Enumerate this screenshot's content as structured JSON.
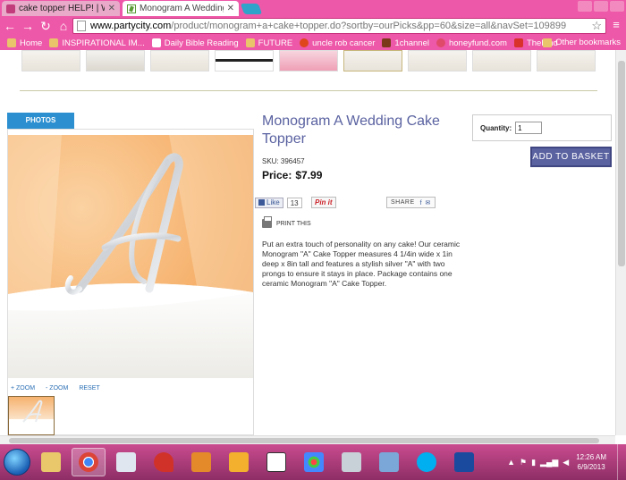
{
  "browser": {
    "tabs": [
      {
        "title": "cake topper HELP! | Wedd",
        "active": false
      },
      {
        "title": "Monogram A Wedding C",
        "active": true
      }
    ],
    "url_host": "www.partycity.com",
    "url_path": "/product/monogram+a+cake+topper.do?sortby=ourPicks&pp=60&size=all&navSet=109899",
    "bookmarks": [
      "Home",
      "INSPIRATIONAL IM...",
      "Daily Bible Reading",
      "FUTURE",
      "uncle rob cancer",
      "1channel",
      "honeyfund.com",
      "TheFind"
    ],
    "other_bookmarks": "Other bookmarks"
  },
  "product": {
    "photos_tab": "PHOTOS",
    "title": "Monogram A Wedding Cake Topper",
    "sku": "SKU: 396457",
    "price_label": "Price:",
    "price": "$7.99",
    "quantity_label": "Quantity:",
    "quantity_value": "1",
    "add_to_basket": "ADD TO BASKET",
    "zoom_in": "+ ZOOM",
    "zoom_out": "- ZOOM",
    "reset": "RESET",
    "like_label": "Like",
    "like_count": "13",
    "pin_label": "Pin it",
    "share_label": "SHARE",
    "print_label": "PRINT THIS",
    "description": "Put an extra touch of personality on any cake! Our ceramic Monogram \"A\" Cake Topper measures 4 1/4in wide x 1in deep x 8in tall and features a stylish silver \"A\" with two prongs to ensure it stays in place. Package contains one ceramic Monogram \"A\" Cake Topper."
  },
  "taskbar": {
    "time": "12:26 AM",
    "date": "6/9/2013"
  },
  "colors": {
    "browser_chrome": "#ee58a8",
    "title_blue": "#5a62a0",
    "photos_tab": "#2b8fd0"
  }
}
